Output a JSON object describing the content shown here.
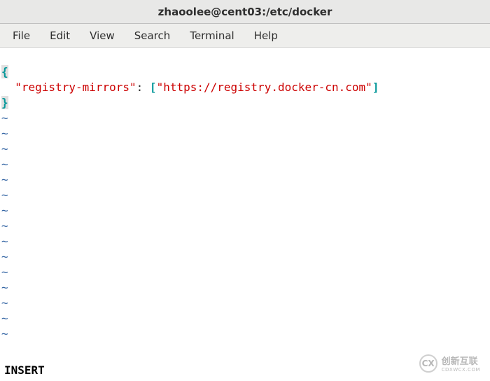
{
  "window": {
    "title": "zhaoolee@cent03:/etc/docker"
  },
  "menu": {
    "items": [
      "File",
      "Edit",
      "View",
      "Search",
      "Terminal",
      "Help"
    ]
  },
  "editor": {
    "json_open_brace": "{",
    "json_key": "\"registry-mirrors\"",
    "json_colon_space": ": ",
    "json_open_bracket": "[",
    "json_value": "\"https://registry.docker-cn.com\"",
    "json_close_bracket": "]",
    "json_close_brace": "}",
    "tilde": "~",
    "mode": "INSERT"
  },
  "watermark": {
    "icon_text": "CX",
    "chinese": "创新互联",
    "pinyin": "CDXWCX.COM"
  },
  "chart_data": null
}
